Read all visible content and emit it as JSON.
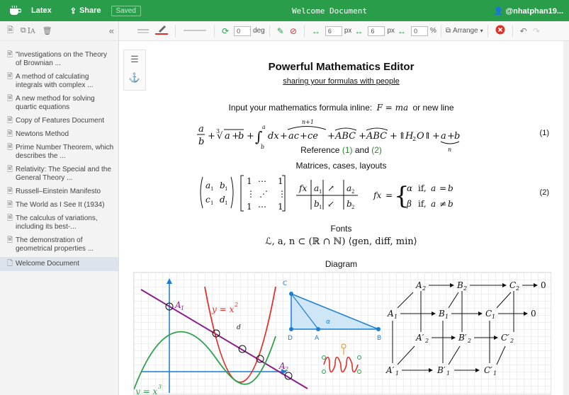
{
  "topbar": {
    "brand": "Latex",
    "share_label": "Share",
    "saved_label": "Saved",
    "document_title": "Welcome Document",
    "user": "@nhatphan19..."
  },
  "left_tools": {
    "collapse": "«"
  },
  "documents": [
    {
      "title": "\"Investigations on the Theory of Brownian ...",
      "icon": "shared-doc-icon"
    },
    {
      "title": "A method of calculating integrals with complex ...",
      "icon": "shared-doc-icon"
    },
    {
      "title": "A new method for solving quartic equations",
      "icon": "doc-icon"
    },
    {
      "title": "Copy of Features Document",
      "icon": "doc-icon"
    },
    {
      "title": "Newtons Method",
      "icon": "doc-icon"
    },
    {
      "title": "Prime Number Theorem, which describes the ...",
      "icon": "doc-icon"
    },
    {
      "title": "Relativity: The Special and the General Theory ...",
      "icon": "shared-doc-icon"
    },
    {
      "title": "Russell–Einstein Manifesto",
      "icon": "doc-icon"
    },
    {
      "title": "The World as I See It (1934)",
      "icon": "doc-icon"
    },
    {
      "title": "The calculus of variations, including its best-...",
      "icon": "doc-icon"
    },
    {
      "title": "The demonstration of geometrical properties ...",
      "icon": "doc-icon"
    },
    {
      "title": "Welcome Document",
      "icon": "doc-outline-icon",
      "active": true
    }
  ],
  "toolbar": {
    "angle_value": "0",
    "angle_unit": "deg",
    "width_value": "6",
    "width_unit": "px",
    "height_value": "6",
    "height_unit": "px",
    "percent_value": "0",
    "percent_unit": "%",
    "arrange_label": "Arrange"
  },
  "document": {
    "title": "Powerful Mathematics Editor",
    "subtitle": "sharing your formulas with people",
    "inline_prefix": "Input your mathematics formula inline:",
    "inline_formula": "F = ma",
    "inline_suffix": "or new line",
    "eq1_number": "(1)",
    "reference_prefix": "Reference",
    "reference_1": "(1)",
    "reference_and": "and",
    "reference_2": "(2)",
    "matrices_heading": "Matrices, cases, layouts",
    "eq2_number": "(2)",
    "fonts_heading": "Fonts",
    "fonts_formula": "ℒ, a, n ⊂ (ℝ ∩ ℕ) ⟨gen, diff, min⟩",
    "diagram_heading": "Diagram"
  },
  "colors": {
    "brand_green": "#2a9d4a",
    "accent_red": "#e0302c",
    "ref_green": "#2a8a2a"
  }
}
